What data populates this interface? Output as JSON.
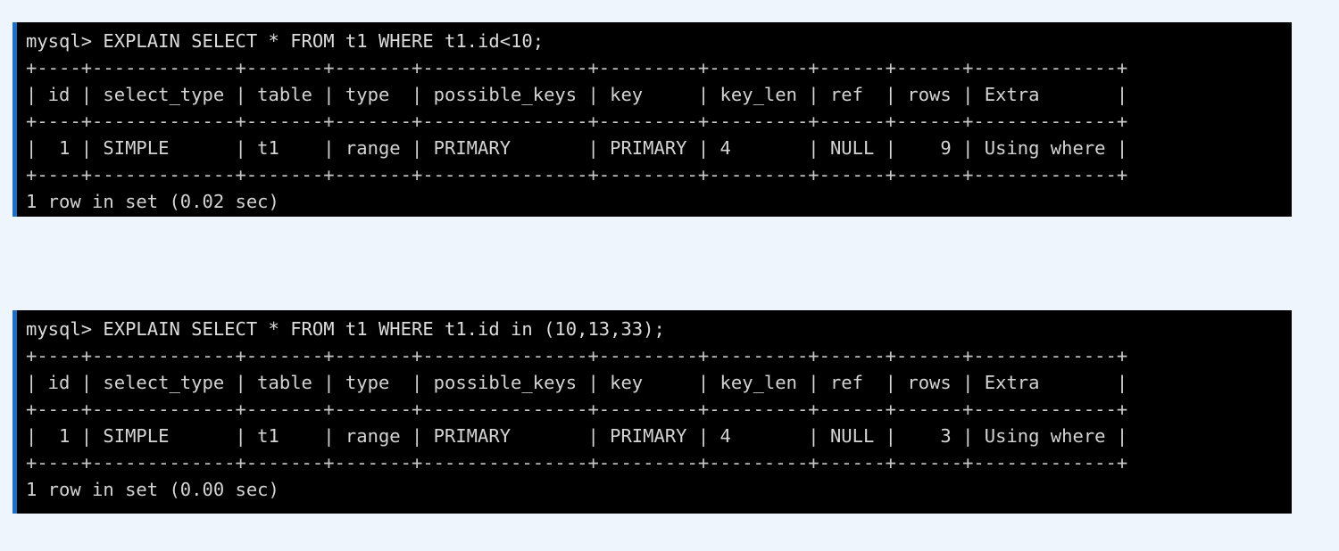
{
  "page": {
    "background_color": "#eef5fc",
    "accent_stripe_color": "#1c6fc4",
    "terminal_background": "#000000",
    "terminal_text_color": "#d4d4d4"
  },
  "blocks": [
    {
      "id": "explain-range-lt",
      "prompt": "mysql> EXPLAIN SELECT * FROM t1 WHERE t1.id<10;",
      "rule_top": "+----+-------------+-------+-------+---------------+---------+---------+------+------+-------------+",
      "header": "| id | select_type | table | type  | possible_keys | key     | key_len | ref  | rows | Extra       |",
      "rule_mid": "+----+-------------+-------+-------+---------------+---------+---------+------+------+-------------+",
      "row": "|  1 | SIMPLE      | t1    | range | PRIMARY       | PRIMARY | 4       | NULL |    9 | Using where |",
      "rule_bottom": "+----+-------------+-------+-------+---------------+---------+---------+------+------+-------------+",
      "status": "1 row in set (0.02 sec)",
      "columns": [
        "id",
        "select_type",
        "table",
        "type",
        "possible_keys",
        "key",
        "key_len",
        "ref",
        "rows",
        "Extra"
      ],
      "values": [
        "1",
        "SIMPLE",
        "t1",
        "range",
        "PRIMARY",
        "PRIMARY",
        "4",
        "NULL",
        "9",
        "Using where"
      ]
    },
    {
      "id": "explain-range-in",
      "prompt": "mysql> EXPLAIN SELECT * FROM t1 WHERE t1.id in (10,13,33);",
      "rule_top": "+----+-------------+-------+-------+---------------+---------+---------+------+------+-------------+",
      "header": "| id | select_type | table | type  | possible_keys | key     | key_len | ref  | rows | Extra       |",
      "rule_mid": "+----+-------------+-------+-------+---------------+---------+---------+------+------+-------------+",
      "row": "|  1 | SIMPLE      | t1    | range | PRIMARY       | PRIMARY | 4       | NULL |    3 | Using where |",
      "rule_bottom": "+----+-------------+-------+-------+---------------+---------+---------+------+------+-------------+",
      "status": "1 row in set (0.00 sec)",
      "columns": [
        "id",
        "select_type",
        "table",
        "type",
        "possible_keys",
        "key",
        "key_len",
        "ref",
        "rows",
        "Extra"
      ],
      "values": [
        "1",
        "SIMPLE",
        "t1",
        "range",
        "PRIMARY",
        "PRIMARY",
        "4",
        "NULL",
        "3",
        "Using where"
      ]
    }
  ]
}
